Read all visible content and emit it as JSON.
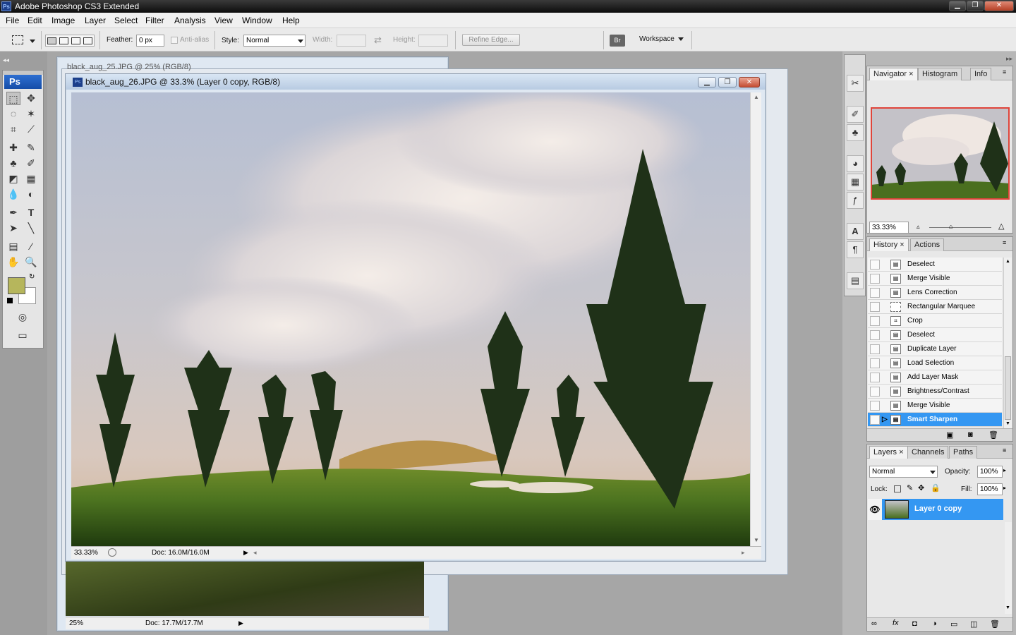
{
  "app": {
    "title": "Adobe Photoshop CS3 Extended",
    "logo": "Ps"
  },
  "window_controls": {
    "minimize": "▁",
    "restore": "❐",
    "close": "✕"
  },
  "menu": [
    "File",
    "Edit",
    "Image",
    "Layer",
    "Select",
    "Filter",
    "Analysis",
    "View",
    "Window",
    "Help"
  ],
  "options": {
    "feather_label": "Feather:",
    "feather_value": "0 px",
    "antialias_label": "Anti-alias",
    "style_label": "Style:",
    "style_value": "Normal",
    "width_label": "Width:",
    "height_label": "Height:",
    "refine_edge": "Refine Edge...",
    "workspace": "Workspace"
  },
  "toolbox": {
    "logo": "Ps",
    "foreground_color": "#b6b65c",
    "background_color": "#ffffff"
  },
  "doc_back": {
    "title": "black_aug_25.JPG @ 25% (RGB/8)",
    "zoom": "25%",
    "doc": "Doc: 17.7M/17.7M"
  },
  "doc_main": {
    "title": "black_aug_26.JPG @ 33.3% (Layer 0 copy, RGB/8)",
    "zoom": "33.33%",
    "doc": "Doc: 16.0M/16.0M"
  },
  "navigator": {
    "tabs": [
      "Navigator",
      "Histogram",
      "Info"
    ],
    "zoom": "33.33%"
  },
  "history": {
    "tabs": [
      "History",
      "Actions"
    ],
    "items": [
      "Deselect",
      "Merge Visible",
      "Lens Correction",
      "Rectangular Marquee",
      "Crop",
      "Deselect",
      "Duplicate Layer",
      "Load Selection",
      "Add Layer Mask",
      "Brightness/Contrast",
      "Merge Visible",
      "Smart Sharpen"
    ],
    "selected": "Smart Sharpen"
  },
  "layers": {
    "tabs": [
      "Layers",
      "Channels",
      "Paths"
    ],
    "blend_mode": "Normal",
    "opacity_label": "Opacity:",
    "opacity": "100%",
    "lock_label": "Lock:",
    "fill_label": "Fill:",
    "fill": "100%",
    "layer_name": "Layer 0 copy"
  },
  "colors": {
    "selection": "#3497f2",
    "navigator_frame": "#e0443a"
  }
}
